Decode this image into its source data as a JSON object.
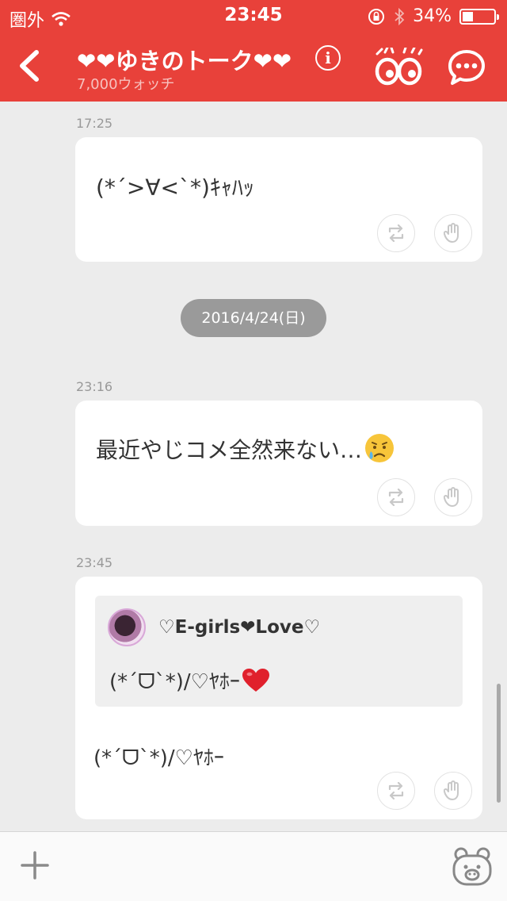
{
  "status_bar": {
    "carrier": "圏外",
    "time": "23:45",
    "battery": "34%",
    "battery_level": 0.34
  },
  "header": {
    "title": "❤❤ゆきのトーク❤❤",
    "watchers": "7,000ウォッチ"
  },
  "messages": [
    {
      "time": "17:25",
      "text": "(*´>∀<`*)ｷｬﾊｯ"
    },
    {
      "date": "2016/4/24(日)"
    },
    {
      "time": "23:16",
      "text": "最近やじコメ全然来ない…"
    },
    {
      "time": "23:45",
      "quote": {
        "author": "♡E-girls❤Love♡",
        "text": "(*´ᗜ`*)/♡ﾔﾎｰ"
      },
      "text": "(*´ᗜ`*)/♡ﾔﾎｰ"
    }
  ],
  "icons": {
    "back": "chevron-left-icon",
    "info": "info-icon",
    "watch": "eyes-icon",
    "more": "speech-bubble-icon",
    "repost": "repost-icon",
    "clap": "hand-icon",
    "add": "plus-icon",
    "stamp": "bear-icon"
  },
  "colors": {
    "header": "#e8413a",
    "background": "#ececec"
  }
}
